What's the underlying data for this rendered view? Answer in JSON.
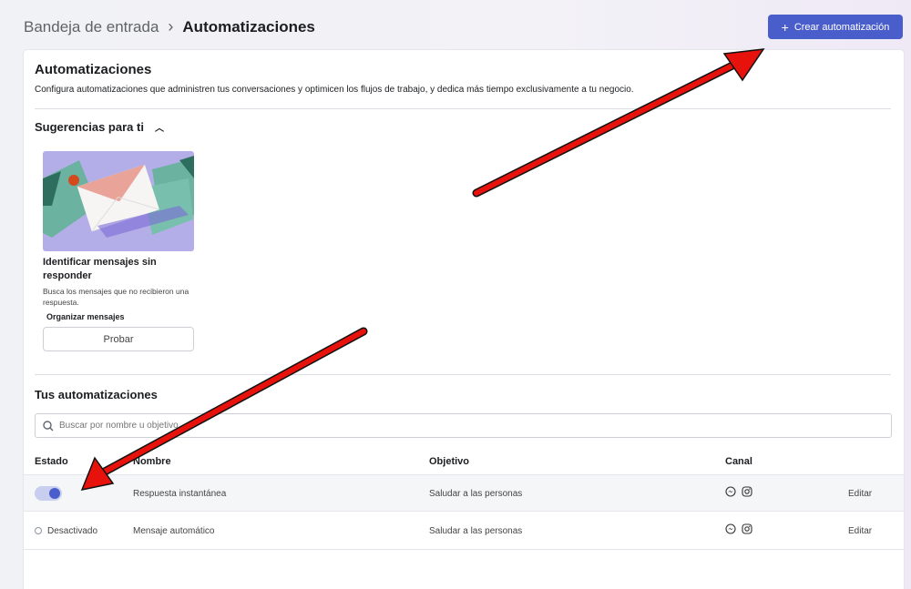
{
  "breadcrumb": {
    "root": "Bandeja de entrada",
    "current": "Automatizaciones"
  },
  "header": {
    "create_label": "Crear automatización",
    "accent": "#4a5ecb"
  },
  "section": {
    "title": "Automatizaciones",
    "description": "Configura automatizaciones que administren tus conversaciones y optimicen los flujos de trabajo, y dedica más tiempo exclusivamente a tu negocio."
  },
  "suggestions": {
    "title": "Sugerencias para ti",
    "card": {
      "title": "Identificar mensajes sin responder",
      "description": "Busca los mensajes que no recibieron una respuesta.",
      "category": "Organizar mensajes",
      "button": "Probar"
    }
  },
  "automations": {
    "title": "Tus automatizaciones",
    "search_placeholder": "Buscar por nombre u objetivo",
    "columns": {
      "status": "Estado",
      "name": "Nombre",
      "goal": "Objetivo",
      "channel": "Canal"
    },
    "rows": [
      {
        "status": "on",
        "status_label": "",
        "name": "Respuesta instantánea",
        "goal": "Saludar a las personas",
        "channels": [
          "messenger-icon",
          "instagram-icon"
        ],
        "action": "Editar"
      },
      {
        "status": "off",
        "status_label": "Desactivado",
        "name": "Mensaje automático",
        "goal": "Saludar a las personas",
        "channels": [
          "messenger-icon",
          "instagram-icon"
        ],
        "action": "Editar"
      }
    ]
  },
  "annotation_color": "#e8120c"
}
